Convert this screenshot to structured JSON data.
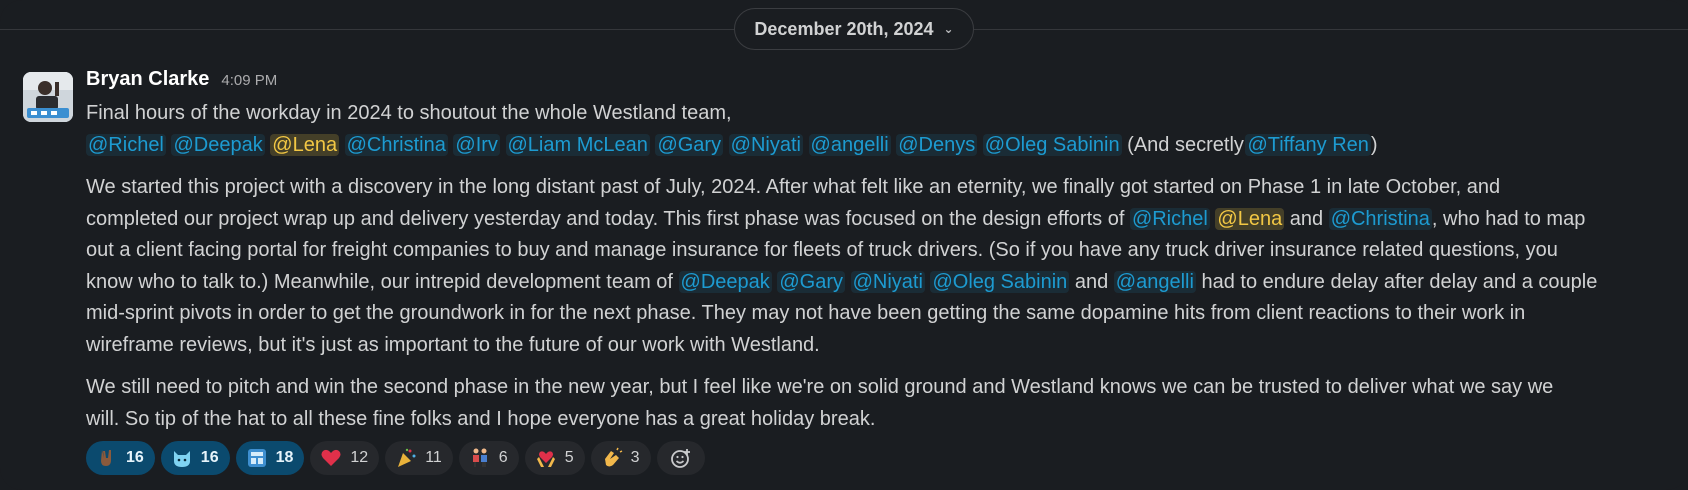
{
  "date_divider": {
    "label": "December 20th, 2024"
  },
  "message": {
    "author": "Bryan Clarke",
    "time": "4:09 PM",
    "intro_text": "Final hours of the workday in 2024 to shoutout the whole Westland team,",
    "mentions": [
      "@Richel",
      "@Deepak",
      "@Lena",
      "@Christina",
      "@Irv",
      "@Liam McLean",
      "@Gary",
      "@Niyati",
      "@angelli",
      "@Denys",
      "@Oleg Sabinin"
    ],
    "secret_prefix": "(And secretly",
    "secret_mention": "@Tiffany Ren",
    "secret_suffix": ")",
    "p1_l1": "We started this project with a discovery in the long distant past of July, 2024. After what felt like an eternity, we finally got started on Phase 1 in late October, and",
    "p1_l2_a": "completed our project wrap up and delivery yesterday and today. This first phase was focused on the design efforts of",
    "p1_l2_m1": "@Richel",
    "p1_l2_m2": "@Lena",
    "p1_l2_and": "and",
    "p1_l2_m3": "@Christina",
    "p1_l2_b": ", who had to map",
    "p1_l3": "out a client facing portal for freight companies to buy and manage insurance for fleets of truck drivers. (So if you have any truck driver insurance related questions, you",
    "p1_l4_a": "know who to talk to.) Meanwhile, our intrepid development team of",
    "p1_l4_m1": "@Deepak",
    "p1_l4_m2": "@Gary",
    "p1_l4_m3": "@Niyati",
    "p1_l4_m4": "@Oleg Sabinin",
    "p1_l4_and": "and",
    "p1_l4_m5": "@angelli",
    "p1_l4_b": "had to endure delay after delay and a couple",
    "p1_l5": "mid-sprint pivots in order to get the groundwork in for the next phase. They may not have been getting the same dopamine hits from client reactions to their work in",
    "p1_l6": "wireframe reviews, but it's just as important to the future of our work with Westland.",
    "p2_l1": "We still need to pitch and win the second phase in the new year, but I feel like we're on solid ground and Westland knows we can be trusted to deliver what we say we",
    "p2_l2": "will. So tip of the hat to all these fine folks and I hope everyone has a great holiday break."
  },
  "reactions": [
    {
      "icon": "rock-on-hand-icon",
      "count": "16"
    },
    {
      "icon": "cat-face-icon",
      "count": "16"
    },
    {
      "icon": "custom-app-icon",
      "count": "18"
    },
    {
      "icon": "red-heart-icon",
      "count": "12"
    },
    {
      "icon": "party-popper-icon",
      "count": "11"
    },
    {
      "icon": "people-dancing-icon",
      "count": "6"
    },
    {
      "icon": "heart-hands-icon",
      "count": "5"
    },
    {
      "icon": "clap-hands-icon",
      "count": "3"
    }
  ],
  "colors": {
    "background": "#1a1d21",
    "mention": "#1d9bd1",
    "self_mention": "#f2c744",
    "reaction_selected": "#0b4a6e"
  }
}
